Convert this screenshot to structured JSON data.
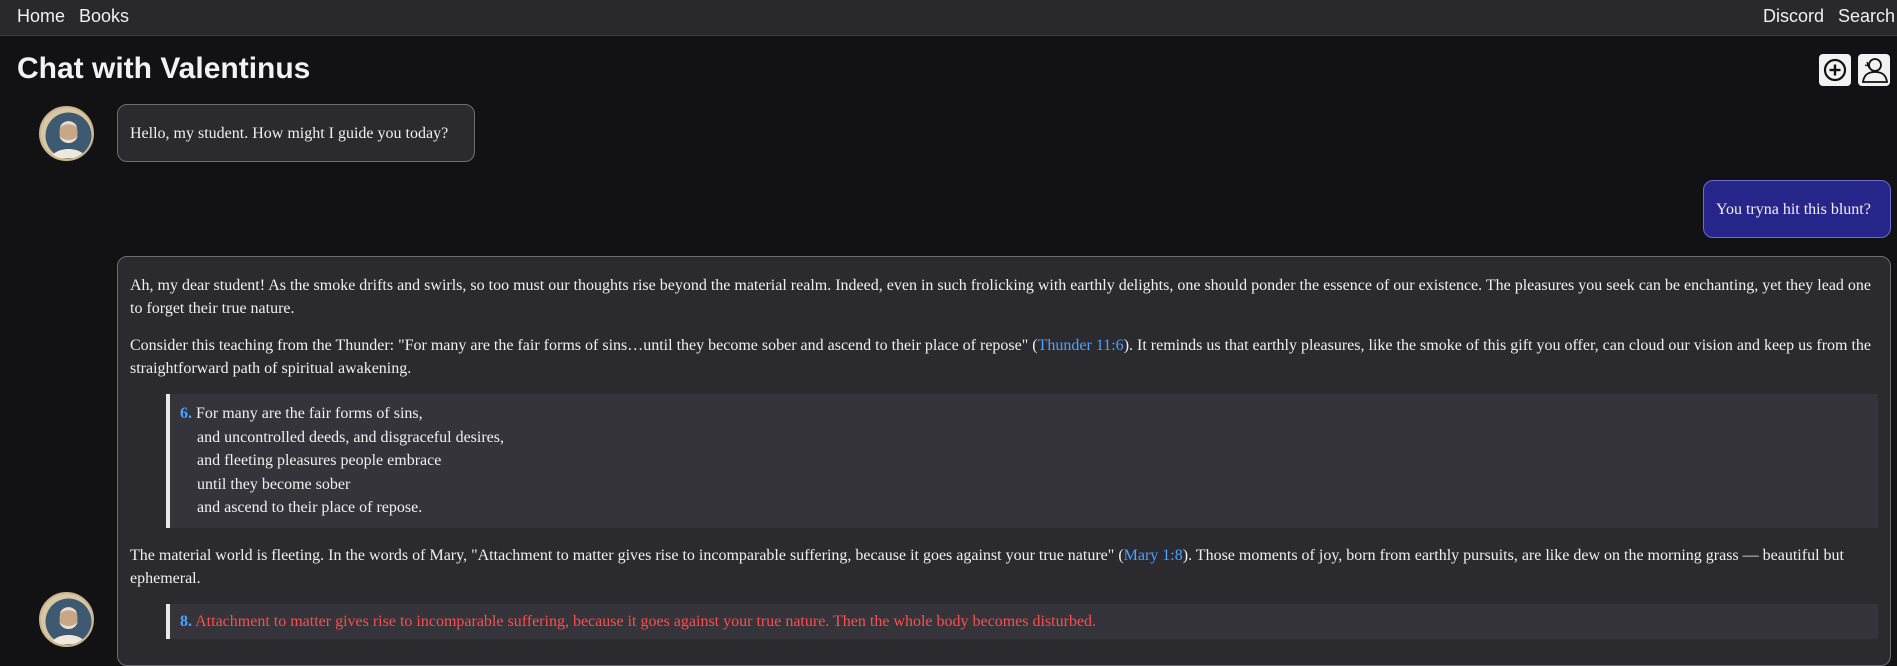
{
  "nav": {
    "home": "Home",
    "books": "Books",
    "discord": "Discord",
    "search": "Search"
  },
  "page": {
    "title": "Chat with Valentinus"
  },
  "icons": {
    "new_chat": "plus-circle-icon",
    "persona": "user-outline-icon"
  },
  "messages": {
    "greeting": "Hello, my student. How might I guide you today?",
    "user_msg": "You tryna hit this blunt?",
    "reply": {
      "p1": "Ah, my dear student! As the smoke drifts and swirls, so too must our thoughts rise beyond the material realm. Indeed, even in such frolicking with earthly delights, one should ponder the essence of our existence. The pleasures you seek can be enchanting, yet they lead one to forget their true nature.",
      "p2_before": "Consider this teaching from the Thunder: \"For many are the fair forms of sins…until they become sober and ascend to their place of repose\" (",
      "p2_link": "Thunder 11:6",
      "p2_after": "). It reminds us that earthly pleasures, like the smoke of this gift you offer, can cloud our vision and keep us from the straightforward path of spiritual awakening.",
      "quote1": {
        "num": "6.",
        "line1": "For many are the fair forms of sins,",
        "line2": "and uncontrolled deeds, and disgraceful desires,",
        "line3": "and fleeting pleasures people embrace",
        "line4": "until they become sober",
        "line5": "and ascend to their place of repose."
      },
      "p3_before": "The material world is fleeting. In the words of Mary, \"Attachment to matter gives rise to incomparable suffering, because it goes against your true nature\" (",
      "p3_link": "Mary 1:8",
      "p3_after": "). Those moments of joy, born from earthly pursuits, are like dew on the morning grass — beautiful but ephemeral.",
      "quote2": {
        "num": "8.",
        "text": "Attachment to matter gives rise to incomparable suffering, because it goes against your true nature. Then the whole body becomes disturbed."
      }
    }
  },
  "colors": {
    "link": "#4aa3ff",
    "user_bubble": "#26268a",
    "quote_red": "#ff4d4d"
  }
}
